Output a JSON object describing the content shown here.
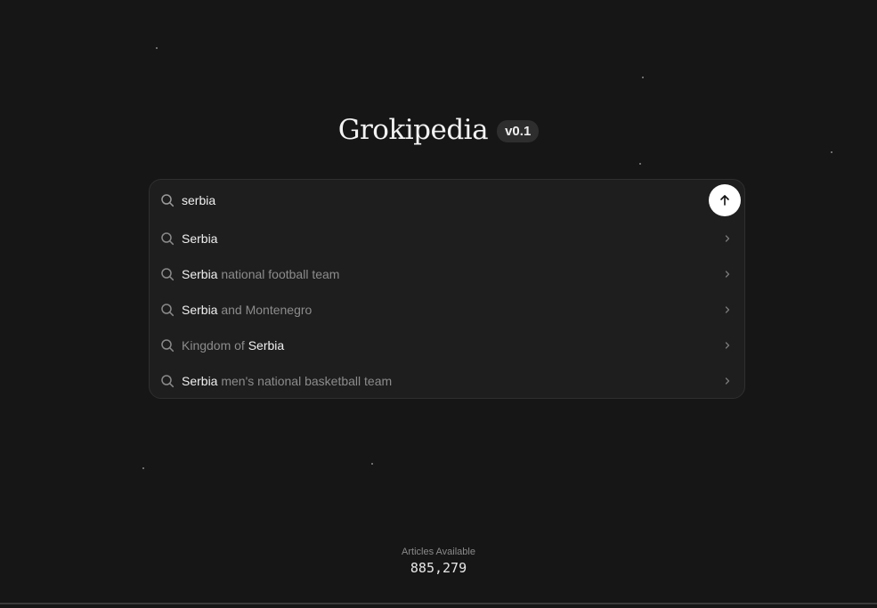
{
  "brand": {
    "title": "Grokipedia",
    "version": "v0.1"
  },
  "search": {
    "value": "serbia",
    "placeholder": "",
    "submit_icon": "arrow-up-icon",
    "search_icon": "search-icon"
  },
  "suggestions": [
    {
      "before": "",
      "match": "Serbia",
      "after": ""
    },
    {
      "before": "",
      "match": "Serbia",
      "after": " national football team"
    },
    {
      "before": "",
      "match": "Serbia",
      "after": " and Montenegro"
    },
    {
      "before": "Kingdom of ",
      "match": "Serbia",
      "after": ""
    },
    {
      "before": "",
      "match": "Serbia",
      "after": " men's national basketball team"
    }
  ],
  "stats": {
    "label": "Articles Available",
    "value": "885,279"
  },
  "colors": {
    "background": "#161616",
    "panel": "#1e1e1e",
    "highlight_text": "#f0f0f0",
    "muted_text": "#8c8c8c"
  }
}
